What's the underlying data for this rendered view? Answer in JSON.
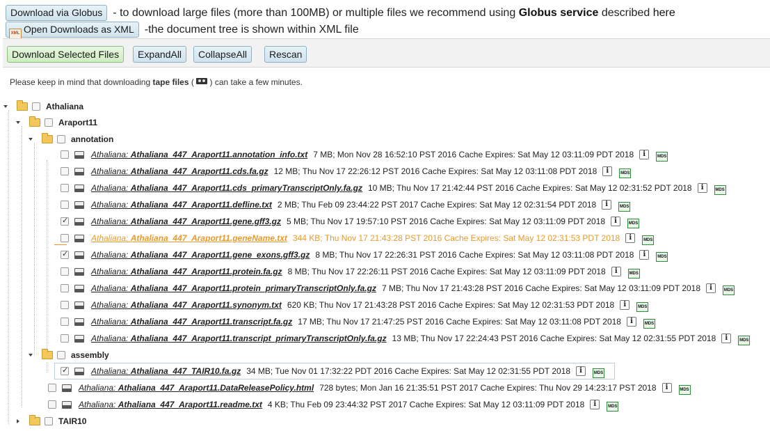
{
  "header": {
    "globus_button": "Download via Globus",
    "globus_desc": "- to download large files (more than 100MB) or multiple files we recommend using",
    "globus_link": "Globus service",
    "globus_desc2": "described",
    "here_link": "here",
    "xml_button": "Open Downloads as XML",
    "xml_desc": "-the document tree is shown within XML file"
  },
  "toolbar": {
    "download_selected": "Download Selected Files",
    "expand_all": "ExpandAll",
    "collapse_all": "CollapseAll",
    "rescan": "Rescan"
  },
  "note": {
    "before": "Please keep in mind that downloading",
    "bold": "tape files",
    "paren_open": " (",
    "after": " ) can take a few minutes."
  },
  "tree": {
    "root": "Athaliana",
    "araport": "Araport11",
    "annotation": "annotation",
    "assembly": "assembly",
    "tair": "TAIR10",
    "prefix": "Athaliana:",
    "info_glyph": "i",
    "mds_label": "MDS",
    "annotation_files": [
      {
        "name": "Athaliana_447_Araport11.annotation_info.txt",
        "meta": "7 MB;  Mon Nov 28 16:52:10 PST 2016  Cache Expires: Sat May 12 03:11:09 PDT 2018",
        "checked": false
      },
      {
        "name": "Athaliana_447_Araport11.cds.fa.gz",
        "meta": "12 MB;  Thu Nov 17 22:26:12 PST 2016  Cache Expires: Sat May 12 03:11:08 PDT 2018",
        "checked": false
      },
      {
        "name": "Athaliana_447_Araport11.cds_primaryTranscriptOnly.fa.gz",
        "meta": "10 MB;  Thu Nov 17 21:42:44 PST 2016  Cache Expires: Sat May 12 02:31:52 PDT 2018",
        "checked": false
      },
      {
        "name": "Athaliana_447_Araport11.defline.txt",
        "meta": "2 MB;  Thu Feb 09 23:44:22 PST 2017  Cache Expires: Sat May 12 02:31:54 PDT 2018",
        "checked": false
      },
      {
        "name": "Athaliana_447_Araport11.gene.gff3.gz",
        "meta": "5 MB;  Thu Nov 17 19:57:10 PST 2016  Cache Expires: Sat May 12 03:11:09 PDT 2018",
        "checked": true
      },
      {
        "name": "Athaliana_447_Araport11.geneName.txt",
        "meta": "344 KB;  Thu Nov 17 21:43:28 PST 2016  Cache Expires: Sat May 12 02:31:53 PDT 2018",
        "checked": false,
        "hover": true
      },
      {
        "name": "Athaliana_447_Araport11.gene_exons.gff3.gz",
        "meta": "8 MB;  Thu Nov 17 22:26:31 PST 2016  Cache Expires: Sat May 12 03:11:08 PDT 2018",
        "checked": true
      },
      {
        "name": "Athaliana_447_Araport11.protein.fa.gz",
        "meta": "8 MB;  Thu Nov 17 22:26:11 PST 2016  Cache Expires: Sat May 12 03:11:09 PDT 2018",
        "checked": false
      },
      {
        "name": "Athaliana_447_Araport11.protein_primaryTranscriptOnly.fa.gz",
        "meta": "7 MB;  Thu Nov 17 21:43:28 PST 2016  Cache Expires: Sat May 12 03:11:09 PDT 2018",
        "checked": false
      },
      {
        "name": "Athaliana_447_Araport11.synonym.txt",
        "meta": "620 KB;  Thu Nov 17 21:43:28 PST 2016  Cache Expires: Sat May 12 02:31:53 PDT 2018",
        "checked": false
      },
      {
        "name": "Athaliana_447_Araport11.transcript.fa.gz",
        "meta": "17 MB;  Thu Nov 17 21:47:25 PST 2016  Cache Expires: Sat May 12 03:11:08 PDT 2018",
        "checked": false
      },
      {
        "name": "Athaliana_447_Araport11.transcript_primaryTranscriptOnly.fa.gz",
        "meta": "13 MB;  Thu Nov 17 22:24:43 PST 2016  Cache Expires: Sat May 12 02:31:55 PDT 2018",
        "checked": false
      }
    ],
    "assembly_files": [
      {
        "name": "Athaliana_447_TAIR10.fa.gz",
        "meta": "34 MB;  Tue Nov 01 17:32:22 PDT 2016  Cache Expires: Sat May 12 02:31:55 PDT 2018",
        "checked": true
      }
    ],
    "araport_files": [
      {
        "name": "Athaliana_447_Araport11.DataReleasePolicy.html",
        "meta": "728 bytes;  Mon Jan 16 21:35:51 PST 2017  Cache Expires: Thu Nov 29 14:23:17 PST 2018",
        "checked": false
      },
      {
        "name": "Athaliana_447_Araport11.readme.txt",
        "meta": "4 KB;  Thu Feb 09 23:44:32 PST 2017  Cache Expires: Sat May 12 03:11:09 PDT 2018",
        "checked": false
      }
    ]
  }
}
